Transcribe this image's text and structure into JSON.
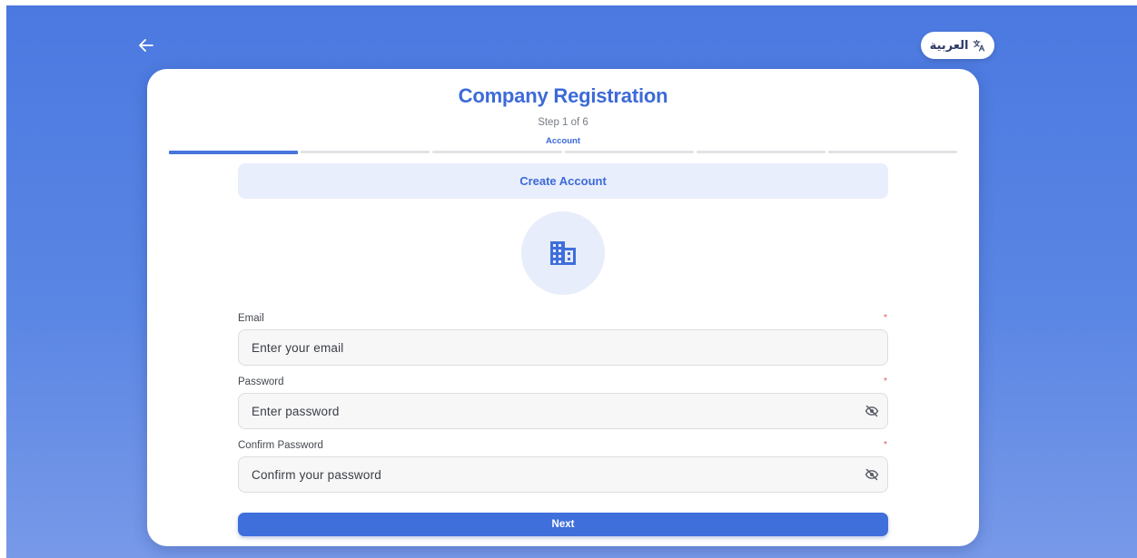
{
  "header": {
    "language_label": "العربية",
    "language_icon": "translate-icon",
    "back_icon": "arrow-left-icon"
  },
  "form": {
    "title": "Company Registration",
    "step_text": "Step 1 of 6",
    "step_name": "Account",
    "progress": {
      "current_step": 1,
      "total_steps": 6
    },
    "section_title": "Create Account",
    "emblem_icon": "building-icon",
    "fields": [
      {
        "label": "Email",
        "placeholder": "Enter your email",
        "required": true
      },
      {
        "label": "Password",
        "placeholder": "Enter password",
        "required": true,
        "toggle_icon": "eye-off-icon"
      },
      {
        "label": "Confirm Password",
        "placeholder": "Confirm your password",
        "required": true,
        "toggle_icon": "eye-off-icon"
      }
    ],
    "required_marker": "*",
    "next_label": "Next"
  },
  "colors": {
    "accent": "#3c6ad8",
    "background_top": "#4b79e0",
    "background_bottom": "#7899e8",
    "required": "#e05555"
  }
}
